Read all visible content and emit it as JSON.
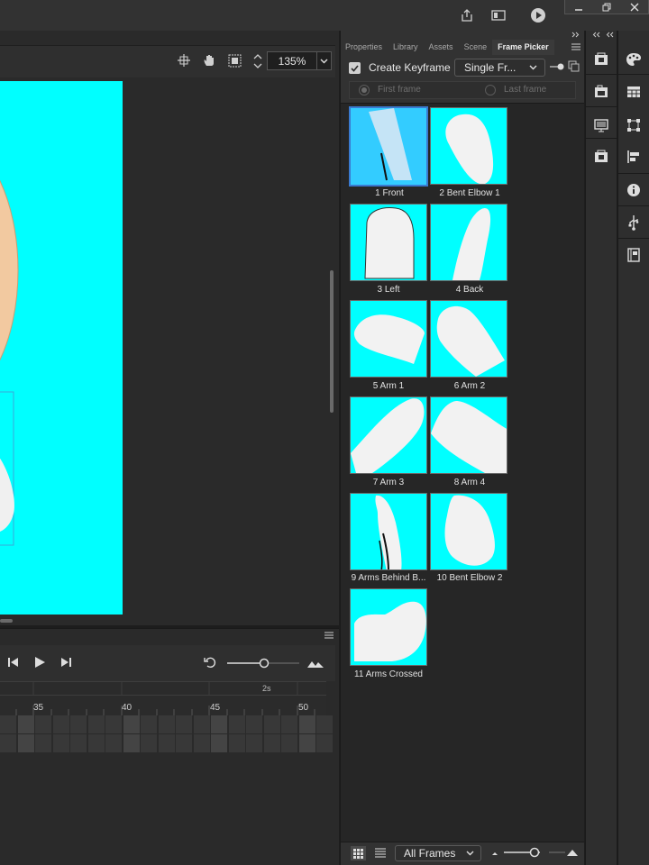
{
  "topbar": {
    "icons": [
      "share-icon",
      "screen-mode-icon",
      "play-icon"
    ],
    "window_controls": [
      "minimize-icon",
      "restore-icon",
      "close-icon"
    ]
  },
  "stage": {
    "zoom": "135%",
    "toolbar_icons": [
      "center-stage-icon",
      "pan-icon",
      "clip-icon"
    ],
    "canvas_color": "#00ffff"
  },
  "timeline": {
    "ruler_numbers": [
      "35",
      "40",
      "45",
      "50"
    ],
    "seconds_marker": "2s",
    "controls": [
      "step-back-icon",
      "play-icon",
      "step-forward-icon",
      "loop-icon",
      "zoom-slider",
      "fit-icon"
    ]
  },
  "panel": {
    "tabs": [
      "Properties",
      "Library",
      "Assets",
      "Scene",
      "Frame Picker"
    ],
    "active_tab": "Frame Picker",
    "create_keyframe_label": "Create Keyframe",
    "create_keyframe_checked": true,
    "frame_mode": "Single Fr...",
    "first_frame_label": "First frame",
    "last_frame_label": "Last frame",
    "frames": [
      {
        "label": "1 Front"
      },
      {
        "label": "2 Bent Elbow 1"
      },
      {
        "label": "3 Left"
      },
      {
        "label": "4 Back"
      },
      {
        "label": "5 Arm 1"
      },
      {
        "label": "6 Arm 2"
      },
      {
        "label": "7 Arm 3"
      },
      {
        "label": "8 Arm 4"
      },
      {
        "label": "9 Arms Behind B..."
      },
      {
        "label": "10 Bent Elbow 2"
      },
      {
        "label": "11 Arms Crossed"
      }
    ],
    "selected_frame": 1,
    "filter": "All Frames",
    "thumbnail_color": "#00ffff",
    "selected_color": "#33ccff"
  },
  "strip1_icons": [
    "library-icon",
    "folder-icon",
    "screen-icon",
    "frame-icon"
  ],
  "strip2_icons": [
    "palette-icon",
    "swatch-icon",
    "transform-icon",
    "align-icon",
    "info-icon",
    "usb-icon",
    "book-icon"
  ]
}
